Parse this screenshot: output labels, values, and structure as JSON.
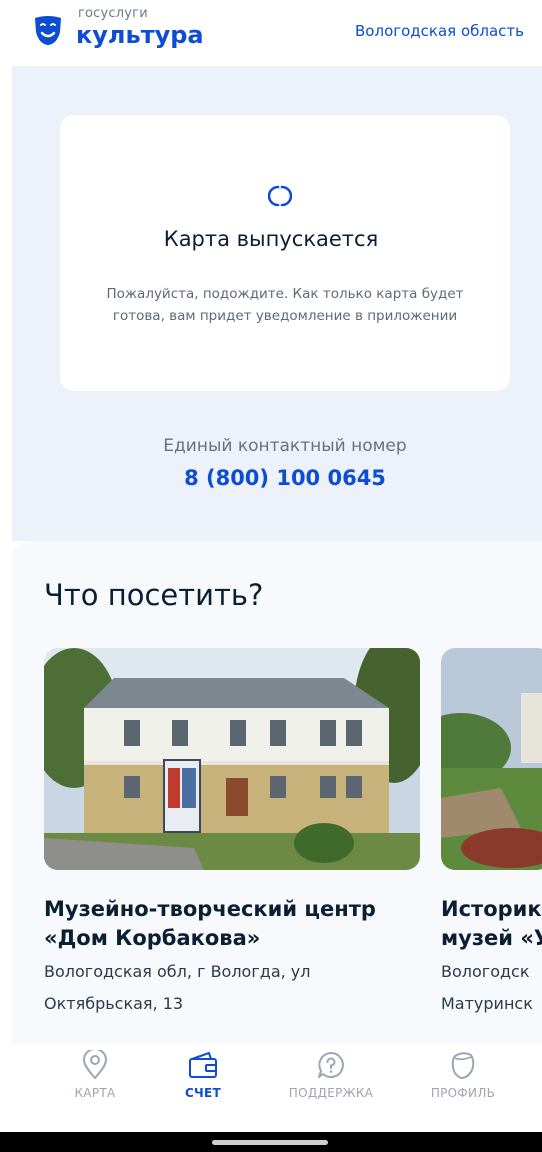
{
  "header": {
    "logo_small": "госуслуги",
    "logo_big": "культура",
    "region": "Вологодская область"
  },
  "status": {
    "title": "Карта выпускается",
    "text": "Пожалуйста, подождите. Как только карта будет готова, вам придет уведомление в приложении",
    "icon": "spinner-icon"
  },
  "contact": {
    "label": "Единый контактный номер",
    "phone": "8 (800) 100 0645"
  },
  "visit": {
    "title": "Что посетить?",
    "places": [
      {
        "name": "Музейно-творческий центр\n«Дом Корбакова»",
        "address": "Вологодская обл, г Вологда, ул\nОктябрьская, 13",
        "image": "museum-building-photo"
      },
      {
        "name": "Историк\nмузей «У",
        "address": "Вологодск\nМатуринск",
        "image": "park-photo"
      }
    ]
  },
  "tabbar": {
    "tabs": [
      {
        "label": "КАРТА",
        "icon": "map-pin-icon",
        "active": false
      },
      {
        "label": "СЧЕТ",
        "icon": "wallet-icon",
        "active": true
      },
      {
        "label": "ПОДДЕРЖКА",
        "icon": "support-icon",
        "active": false
      },
      {
        "label": "ПРОФИЛЬ",
        "icon": "profile-icon",
        "active": false
      }
    ]
  },
  "colors": {
    "accent": "#0d4cd3",
    "background": "#edf2fa",
    "text": "#0b1f33"
  }
}
